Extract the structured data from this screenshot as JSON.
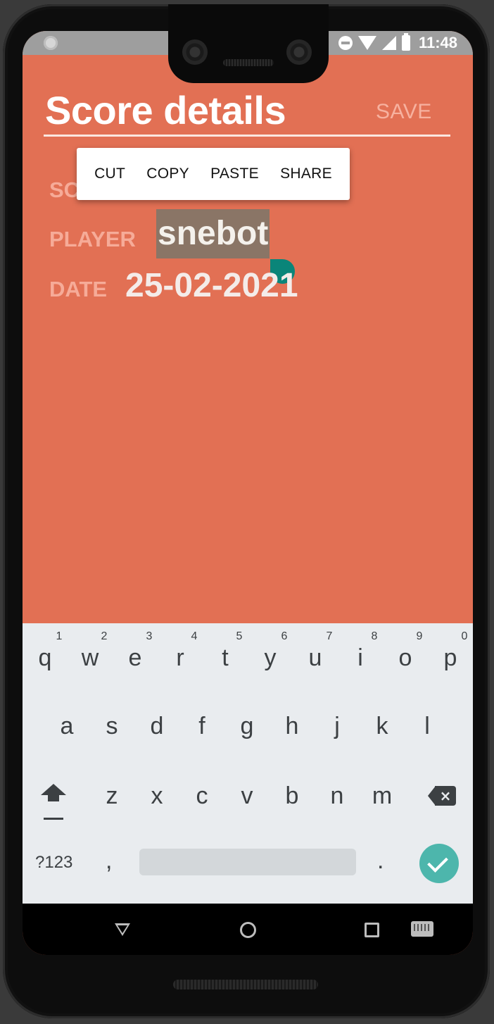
{
  "status_bar": {
    "time": "11:48",
    "icons": [
      "notification-dot-icon",
      "do-not-disturb-icon",
      "wifi-icon",
      "signal-icon",
      "battery-icon"
    ]
  },
  "app": {
    "title": "Score details",
    "save_label": "SAVE",
    "background_color": "#e27054",
    "fields": {
      "score_label": "SCORE",
      "player_label": "PLAYER",
      "player_value": "snebot",
      "date_label": "DATE",
      "date_value": "25-02-2021"
    }
  },
  "context_menu": {
    "items": [
      "CUT",
      "COPY",
      "PASTE",
      "SHARE"
    ]
  },
  "keyboard": {
    "row1": [
      "q",
      "w",
      "e",
      "r",
      "t",
      "y",
      "u",
      "i",
      "o",
      "p"
    ],
    "row1_hints": [
      "1",
      "2",
      "3",
      "4",
      "5",
      "6",
      "7",
      "8",
      "9",
      "0"
    ],
    "row2": [
      "a",
      "s",
      "d",
      "f",
      "g",
      "h",
      "j",
      "k",
      "l"
    ],
    "row3": [
      "z",
      "x",
      "c",
      "v",
      "b",
      "n",
      "m"
    ],
    "symbols_label": "?123",
    "comma": ",",
    "period": ".",
    "accent_color": "#4db6ac"
  },
  "nav_bar": {
    "icons": [
      "back-icon",
      "home-icon",
      "recents-icon",
      "keyboard-switch-icon"
    ]
  }
}
